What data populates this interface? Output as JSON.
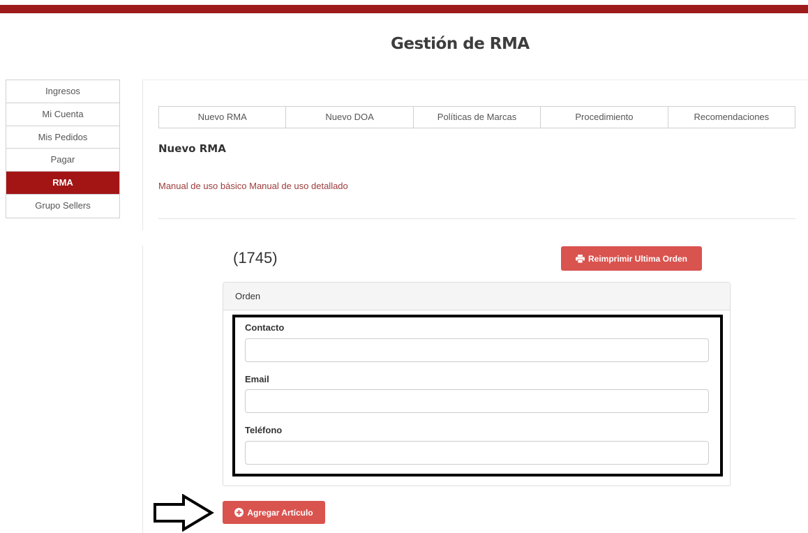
{
  "header": {
    "title": "Gestión de RMA"
  },
  "sidebar": {
    "items": [
      {
        "label": "Ingresos"
      },
      {
        "label": "Mi Cuenta"
      },
      {
        "label": "Mis Pedidos"
      },
      {
        "label": "Pagar"
      },
      {
        "label": "RMA",
        "active": true
      },
      {
        "label": "Grupo Sellers"
      }
    ]
  },
  "tabs": [
    {
      "label": "Nuevo RMA"
    },
    {
      "label": "Nuevo DOA"
    },
    {
      "label": "Políticas de Marcas"
    },
    {
      "label": "Procedimiento"
    },
    {
      "label": "Recomendaciones"
    }
  ],
  "section": {
    "title": "Nuevo RMA",
    "links": [
      {
        "label": "Manual de uso básico"
      },
      {
        "label": "Manual de uso detallado"
      }
    ]
  },
  "order": {
    "number": "(1745)",
    "reprint_label": "Reimprimir Ultima Orden",
    "panel_title": "Orden",
    "fields": [
      {
        "label": "Contacto",
        "value": ""
      },
      {
        "label": "Email",
        "value": ""
      },
      {
        "label": "Teléfono",
        "value": ""
      }
    ],
    "add_label": "Agregar Artículo"
  },
  "colors": {
    "brand_red": "#9e1b1b",
    "sidebar_active": "#a31515",
    "button_red": "#d9534f",
    "link_color": "#9e3a3a"
  },
  "icons": {
    "reprint": "print-icon",
    "add": "plus-circle-icon",
    "annotation": "arrow-right-outline-icon"
  }
}
